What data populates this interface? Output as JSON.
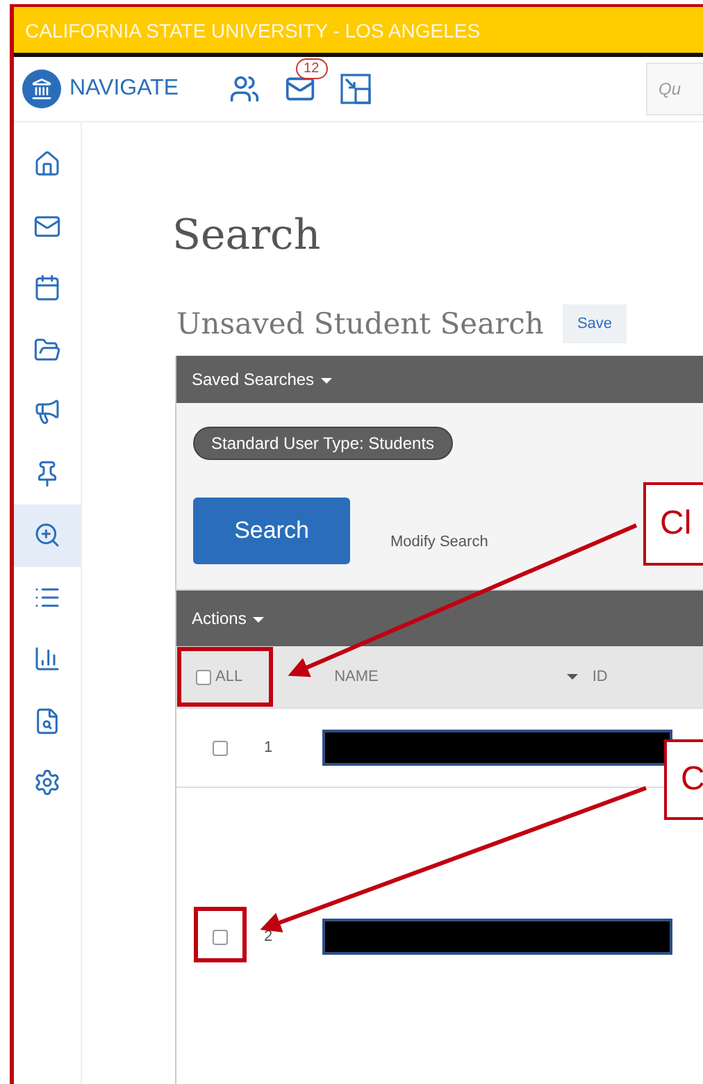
{
  "banner": {
    "title": "CALIFORNIA STATE UNIVERSITY - LOS ANGELES"
  },
  "header": {
    "brand": "NAVIGATE",
    "message_count": "12",
    "search": {
      "placeholder": "Qu"
    }
  },
  "sidebar": {
    "items": [
      {
        "selected": false
      },
      {
        "selected": false
      },
      {
        "selected": false
      },
      {
        "selected": false
      },
      {
        "selected": false
      },
      {
        "selected": false
      },
      {
        "selected": true
      },
      {
        "selected": false
      },
      {
        "selected": false
      },
      {
        "selected": false
      },
      {
        "selected": false
      }
    ]
  },
  "page": {
    "title": "Search",
    "subtitle": "Unsaved Student Search",
    "save_button": "Save"
  },
  "panel": {
    "saved_searches": "Saved Searches",
    "filter_chip": "Standard User Type: Students",
    "search_button": "Search",
    "modify_link": "Modify Search"
  },
  "table": {
    "actions": "Actions",
    "select_all": {
      "label": "ALL",
      "checked": false
    },
    "columns": [
      "NAME",
      "ID"
    ],
    "rows": [
      {
        "number": "1",
        "checked": false
      },
      {
        "number": "2",
        "checked": false
      }
    ]
  },
  "annotations": [
    {
      "callout": "Cl"
    },
    {
      "callout": "C"
    }
  ]
}
